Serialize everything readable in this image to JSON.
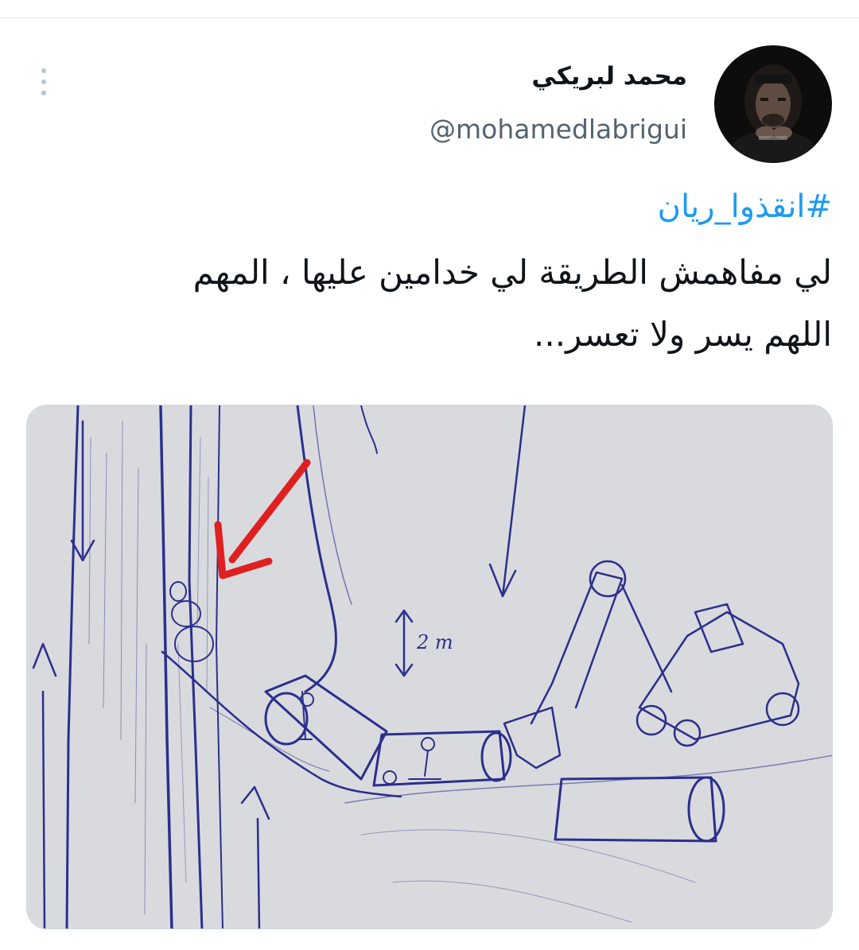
{
  "tweet": {
    "author": {
      "display_name": "محمد لبريكي",
      "handle": "@mohamedlabrigui"
    },
    "hashtag": "#انقذوا_ريان",
    "text_lines": [
      "لي مفاهمش الطريقة لي خدامين عليها ، المهم",
      "اللهم يسر ولا تعسر..."
    ],
    "media": {
      "kind": "hand-drawn sketch",
      "label": "2 m"
    }
  },
  "icons": {
    "more": "more-vertical-icon"
  },
  "colors": {
    "link": "#1d9bf0",
    "text": "#0f1419",
    "secondary": "#536471",
    "ink": "#2b2f8c",
    "arrow": "#e02020"
  }
}
